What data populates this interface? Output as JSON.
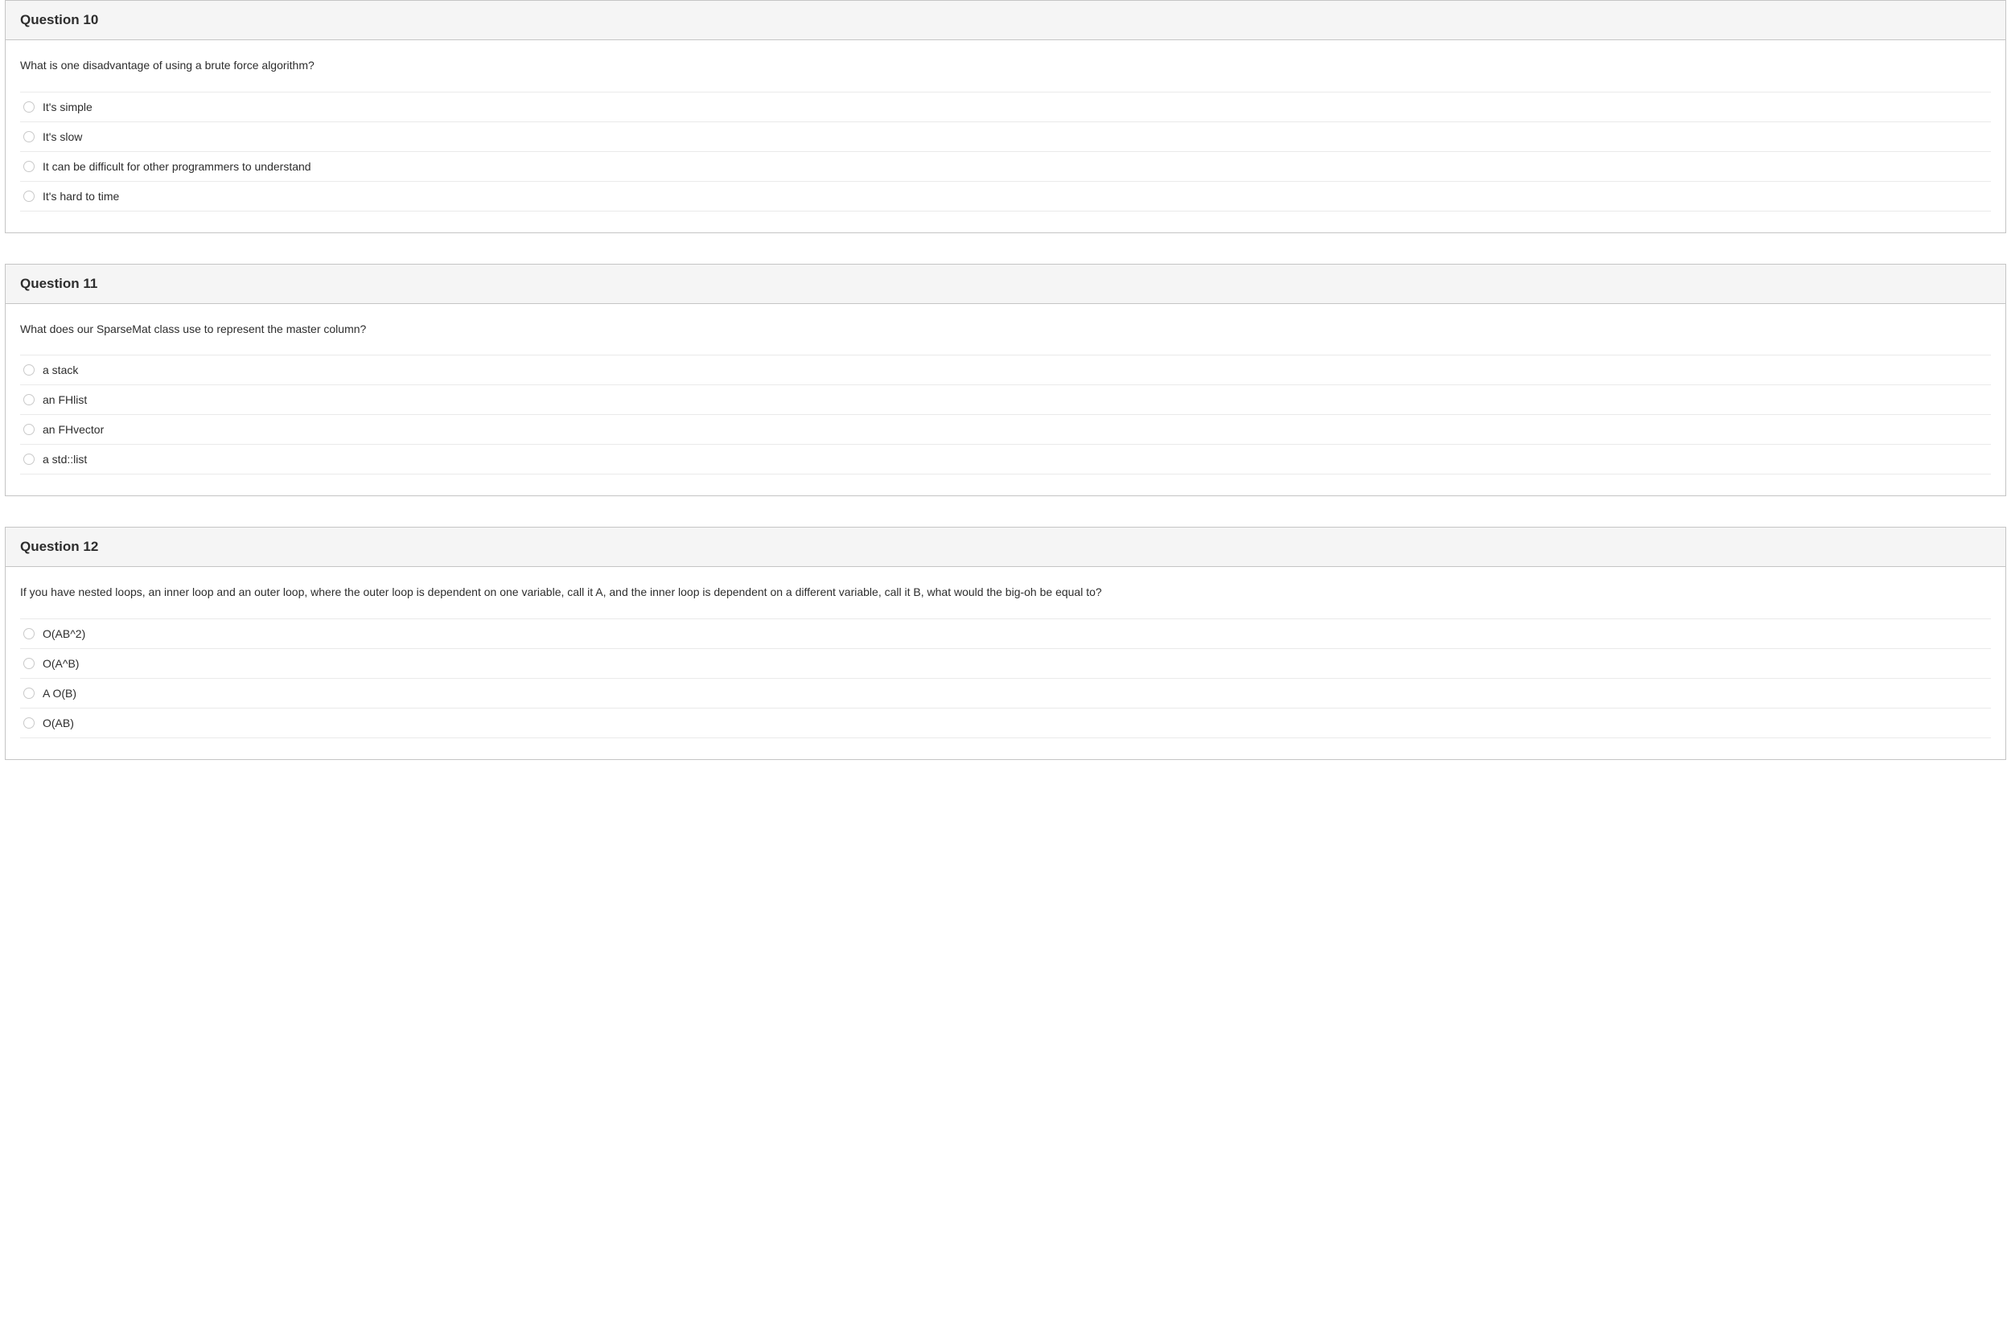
{
  "questions": [
    {
      "title": "Question 10",
      "prompt": "What is one disadvantage of using a brute force algorithm?",
      "answers": [
        "It's simple",
        "It's slow",
        "It can be difficult for other programmers to understand",
        "It's hard to time"
      ]
    },
    {
      "title": "Question 11",
      "prompt": "What does our SparseMat class use to represent the master column?",
      "answers": [
        "a stack",
        "an FHlist",
        "an FHvector",
        "a std::list"
      ]
    },
    {
      "title": "Question 12",
      "prompt": "If you have nested loops, an inner loop and an outer loop, where the outer loop is dependent on one variable, call it A, and the inner loop is dependent on a different variable, call it B, what would the big-oh be equal to?",
      "answers": [
        "O(AB^2)",
        "O(A^B)",
        "A O(B)",
        "O(AB)"
      ]
    }
  ]
}
